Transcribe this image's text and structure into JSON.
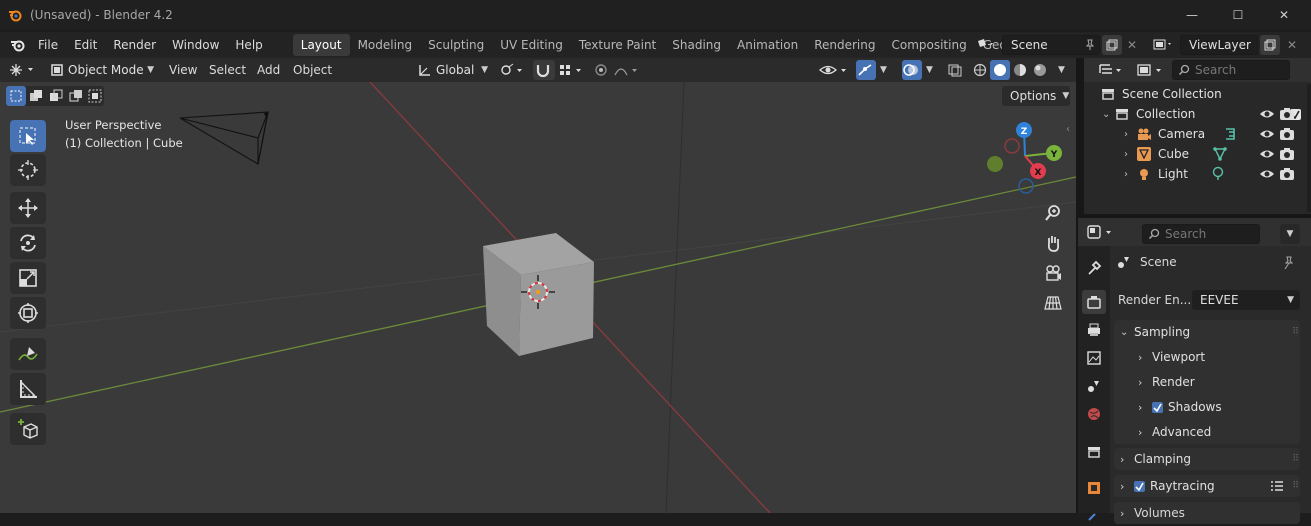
{
  "titlebar": {
    "title": "(Unsaved) - Blender 4.2",
    "minimize": "—",
    "maximize": "☐",
    "close": "✕"
  },
  "menubar": {
    "items": [
      "File",
      "Edit",
      "Render",
      "Window",
      "Help"
    ],
    "workspaces": [
      "Layout",
      "Modeling",
      "Sculpting",
      "UV Editing",
      "Texture Paint",
      "Shading",
      "Animation",
      "Rendering",
      "Compositing",
      "Geo"
    ],
    "active_workspace": "Layout",
    "scene": "Scene",
    "view_layer": "ViewLayer"
  },
  "viewport_header": {
    "mode": "Object Mode",
    "menus": [
      "View",
      "Select",
      "Add",
      "Object"
    ],
    "transform_orientation": "Global",
    "options_label": "Options"
  },
  "viewport": {
    "perspective_label": "User Perspective",
    "collection_label": "(1) Collection | Cube",
    "gizmo": {
      "x": "X",
      "y": "Y",
      "z": "Z"
    }
  },
  "outliner": {
    "search_placeholder": "Search",
    "scene_collection": "Scene Collection",
    "collection": "Collection",
    "objects": [
      {
        "name": "Camera",
        "icon": "camera-icon"
      },
      {
        "name": "Cube",
        "icon": "mesh-icon"
      },
      {
        "name": "Light",
        "icon": "light-icon"
      }
    ]
  },
  "properties": {
    "search_placeholder": "Search",
    "context": "Scene",
    "render_engine_label": "Render En...",
    "render_engine_value": "EEVEE",
    "panels": {
      "sampling": "Sampling",
      "viewport": "Viewport",
      "render": "Render",
      "shadows": "Shadows",
      "advanced": "Advanced",
      "clamping": "Clamping",
      "raytracing": "Raytracing",
      "volumes": "Volumes"
    }
  },
  "colors": {
    "accent": "#4772b3",
    "x_axis": "#e23c4f",
    "y_axis": "#7ab33b",
    "z_axis": "#2f82d9"
  }
}
